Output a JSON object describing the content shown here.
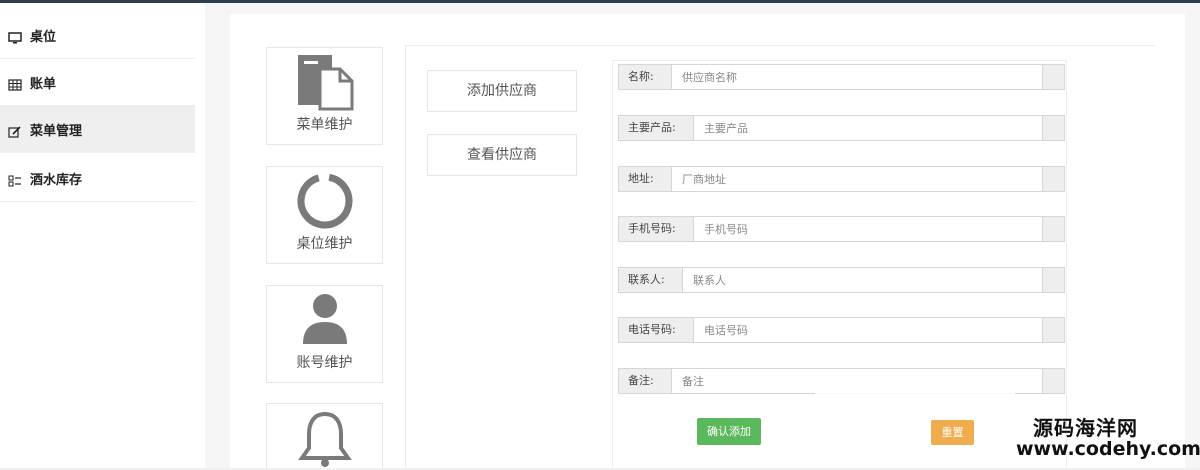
{
  "sidebar": {
    "items": [
      {
        "label": "桌位",
        "icon": "monitor-icon"
      },
      {
        "label": "账单",
        "icon": "table-grid-icon"
      },
      {
        "label": "菜单管理",
        "icon": "edit-icon"
      },
      {
        "label": "酒水库存",
        "icon": "list-icon"
      }
    ],
    "active_index": 2
  },
  "tiles": [
    {
      "label": "菜单维护",
      "icon": "document-icon"
    },
    {
      "label": "桌位维护",
      "icon": "ring-icon"
    },
    {
      "label": "账号维护",
      "icon": "user-icon"
    },
    {
      "label": "",
      "icon": "bell-icon"
    }
  ],
  "supplier_nav": {
    "add_label": "添加供应商",
    "view_label": "查看供应商"
  },
  "form": {
    "fields": [
      {
        "label": "名称:",
        "placeholder": "供应商名称"
      },
      {
        "label": "主要产品:",
        "placeholder": "主要产品"
      },
      {
        "label": "地址:",
        "placeholder": "厂商地址"
      },
      {
        "label": "手机号码:",
        "placeholder": "手机号码"
      },
      {
        "label": "联系人:",
        "placeholder": "联系人"
      },
      {
        "label": "电话号码:",
        "placeholder": "电话号码"
      },
      {
        "label": "备注:",
        "placeholder": "备注"
      }
    ],
    "submit_label": "确认添加",
    "reset_label": "重置"
  },
  "colors": {
    "submit": "#5cb85c",
    "reset": "#f0ad4e",
    "icon_gray": "#7a7a7a"
  },
  "watermark": {
    "line1": "源码海洋网",
    "line2": "www.codehy.com"
  }
}
